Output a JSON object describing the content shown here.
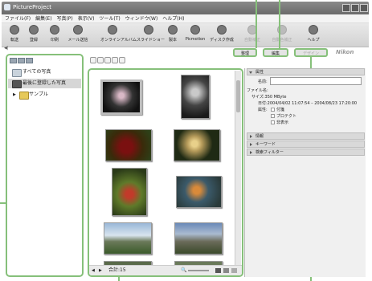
{
  "window": {
    "title": "PictureProject"
  },
  "menu": [
    "ファイル(F)",
    "編集(E)",
    "写真(P)",
    "表示(V)",
    "ツール(T)",
    "ウィンドウ(W)",
    "ヘルプ(H)"
  ],
  "toolbar": {
    "items": [
      {
        "label": "転送",
        "icon": "transfer-icon"
      },
      {
        "label": "登録",
        "icon": "register-icon"
      },
      {
        "label": "印刷",
        "icon": "print-icon"
      },
      {
        "label": "メール送信",
        "icon": "mail-icon"
      },
      {
        "label": "オンラインアルバム",
        "icon": "online-album-icon"
      },
      {
        "label": "スライドショー",
        "icon": "slideshow-icon"
      },
      {
        "label": "製本",
        "icon": "binding-icon"
      },
      {
        "label": "Picmotion",
        "icon": "picmotion-icon"
      },
      {
        "label": "ディスク作成",
        "icon": "disc-icon"
      },
      {
        "label": "自動補正",
        "icon": "auto-correct-icon"
      },
      {
        "label": "自動色補正",
        "icon": "auto-color-icon"
      },
      {
        "label": "ヘルプ",
        "icon": "help-icon"
      }
    ],
    "collapse": "◀|"
  },
  "tabs": {
    "organize": "整理",
    "edit": "編集",
    "design": "デザイン"
  },
  "brand": "Nikon",
  "nav": {
    "all_photos": "すべての写真",
    "recent": "最後に登録した写真",
    "sample": "サンプル"
  },
  "status": {
    "total": "合計:15"
  },
  "properties": {
    "header": "属性",
    "name_label": "名前:",
    "filename_label": "ファイル名:",
    "size": "サイズ:350 MByte",
    "date": "日付:2004/04/02 11:07:54 – 2004/08/23 17:20:00",
    "attr_label": "属性:",
    "checks": [
      "付箋",
      "プロテクト",
      "非表示"
    ]
  },
  "sections": [
    "情報",
    "キーワード",
    "検索フィルター"
  ],
  "colors": {
    "accent": "#86c07a",
    "selected_nav": "#d6d6d6"
  }
}
